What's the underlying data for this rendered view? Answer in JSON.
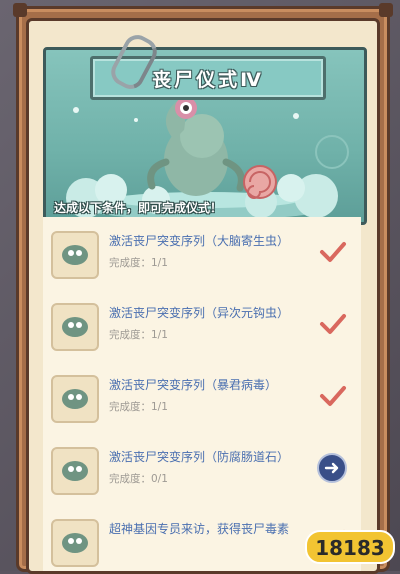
{
  "ritual": {
    "title": "丧尸仪式Ⅳ",
    "caption": "达成以下条件，即可完成仪式！"
  },
  "tasks": [
    {
      "title": "激活丧尸突变序列（大脑寄生虫）",
      "progress": "完成度：1/1",
      "status": "completed"
    },
    {
      "title": "激活丧尸突变序列（异次元钩虫）",
      "progress": "完成度：1/1",
      "status": "completed"
    },
    {
      "title": "激活丧尸突变序列（暴君病毒）",
      "progress": "完成度：1/1",
      "status": "completed"
    },
    {
      "title": "激活丧尸突变序列（防腐肠道石）",
      "progress": "完成度：0/1",
      "status": "go"
    },
    {
      "title": "超神基因专员来访，获得丧尸毒素",
      "progress": "",
      "status": "completed"
    }
  ],
  "icons": {
    "task": "brain-creature-icon",
    "completed": "check-mark-icon",
    "go": "arrow-right-icon"
  },
  "watermark": {
    "text": "18183"
  },
  "colors": {
    "frame": "#a56e49",
    "panel": "#f3e7cc",
    "banner": "#5ea39c",
    "task_title": "#4a6fb0",
    "check": "#d9685e",
    "go_button": "#3a4f88"
  }
}
